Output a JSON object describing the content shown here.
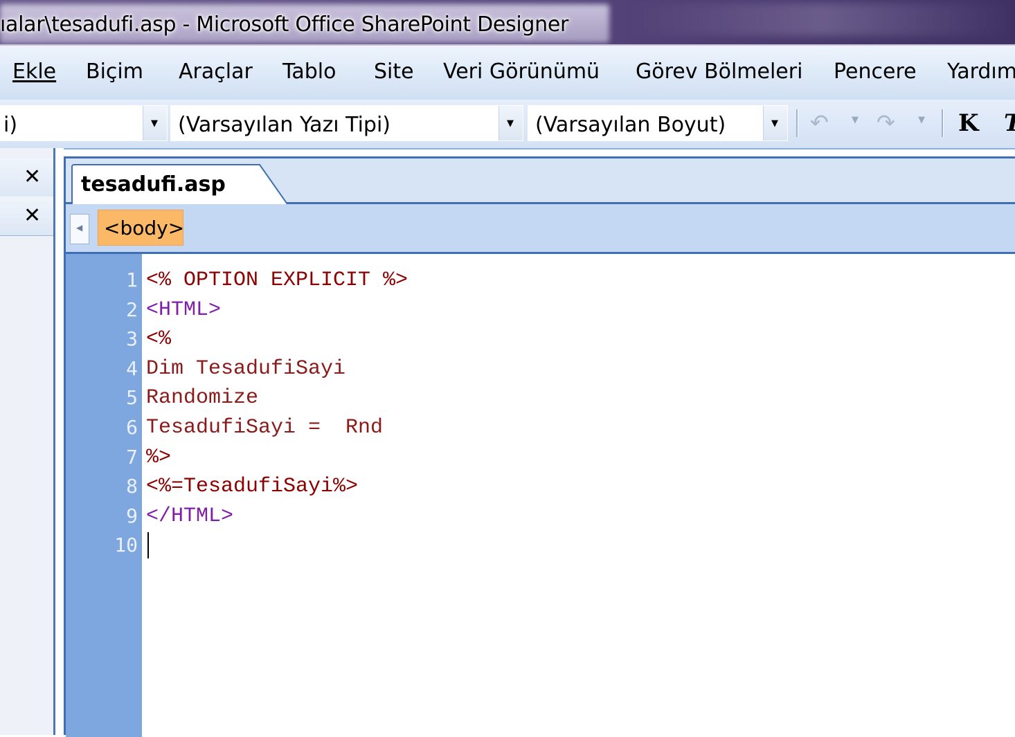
{
  "window": {
    "title": "ıalar\\tesadufi.asp - Microsoft Office SharePoint Designer"
  },
  "menu": {
    "items": [
      {
        "label": "Ekle"
      },
      {
        "label": "Biçim"
      },
      {
        "label": "Araçlar"
      },
      {
        "label": "Tablo"
      },
      {
        "label": "Site"
      },
      {
        "label": "Veri Görünümü"
      },
      {
        "label": "Görev Bölmeleri"
      },
      {
        "label": "Pencere"
      },
      {
        "label": "Yardım"
      }
    ]
  },
  "toolbar": {
    "style_value": "i)",
    "font_value": "(Varsayılan Yazı Tipi)",
    "size_value": "(Varsayılan Boyut)",
    "bold_label": "K",
    "italic_label": "T"
  },
  "document": {
    "tab_label": "tesadufi.asp",
    "tag_selector": "<body>",
    "lines": [
      {
        "n": "1",
        "text": "<% OPTION EXPLICIT %>"
      },
      {
        "n": "2",
        "text": "<HTML>"
      },
      {
        "n": "3",
        "text": "<%"
      },
      {
        "n": "4",
        "text": "Dim TesadufiSayi"
      },
      {
        "n": "5",
        "text": "Randomize"
      },
      {
        "n": "6",
        "text": "TesadufiSayi =  Rnd"
      },
      {
        "n": "7",
        "text": "%>"
      },
      {
        "n": "8",
        "text": "<%=TesadufiSayi%>"
      },
      {
        "n": "9",
        "text": "</HTML>"
      },
      {
        "n": "10",
        "text": ""
      }
    ]
  },
  "colors": {
    "asp_delimiter": "#8b0000",
    "html_tag": "#7f1fa8",
    "keyword": "#8b1a1a",
    "gutter": "#7ea7df",
    "tag_highlight": "#fbb866"
  },
  "icons": {
    "undo": "undo-icon",
    "redo": "redo-icon",
    "close": "close-icon",
    "scroll_left": "scroll-left-icon"
  }
}
